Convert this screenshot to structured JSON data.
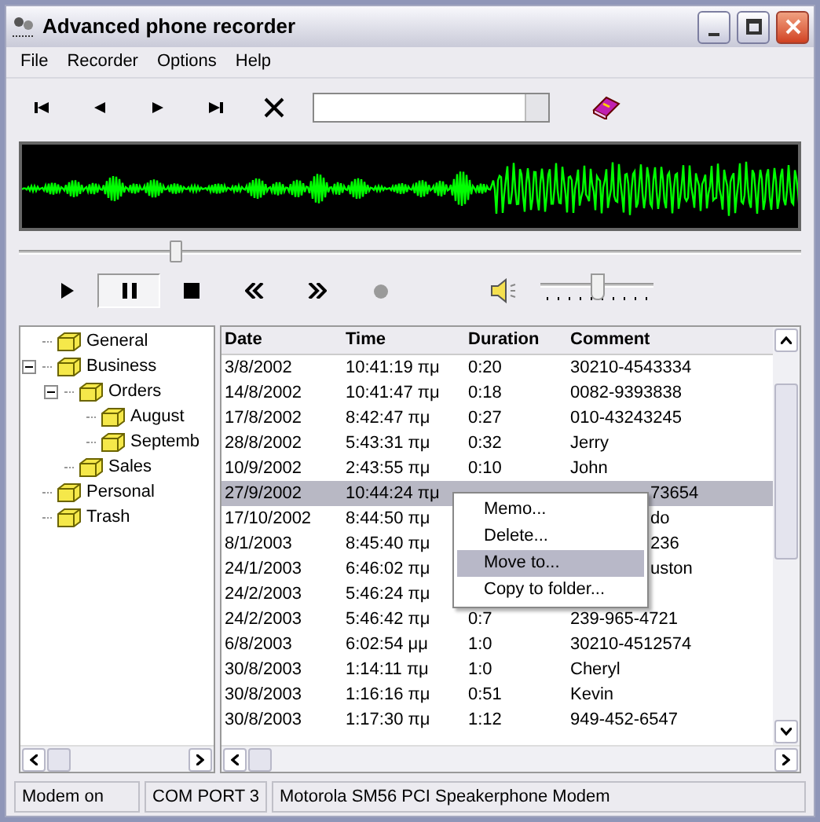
{
  "window": {
    "title": "Advanced phone recorder"
  },
  "menu": [
    "File",
    "Recorder",
    "Options",
    "Help"
  ],
  "position_slider": {
    "level": 0.2
  },
  "transport": [
    {
      "kind": "play",
      "pressed": false,
      "disabled": false
    },
    {
      "kind": "pause",
      "pressed": true,
      "disabled": false
    },
    {
      "kind": "stop",
      "pressed": false,
      "disabled": false
    },
    {
      "kind": "rewind",
      "pressed": false,
      "disabled": false
    },
    {
      "kind": "forward",
      "pressed": false,
      "disabled": false
    },
    {
      "kind": "record",
      "pressed": false,
      "disabled": true
    }
  ],
  "volume_slider": {
    "level": 0.5
  },
  "tree": [
    {
      "label": "General"
    },
    {
      "label": "Business",
      "expanded": true,
      "children": [
        {
          "label": "Orders",
          "expanded": true,
          "children": [
            {
              "label": "August"
            },
            {
              "label": "Septemb"
            }
          ]
        },
        {
          "label": "Sales"
        }
      ]
    },
    {
      "label": "Personal"
    },
    {
      "label": "Trash"
    }
  ],
  "table": {
    "columns": [
      "Date",
      "Time",
      "Duration",
      "Comment"
    ],
    "rows": [
      {
        "date": "3/8/2002",
        "time": "10:41:19 πμ",
        "duration": "0:20",
        "comment": "30210-4543334",
        "selected": false
      },
      {
        "date": "14/8/2002",
        "time": "10:41:47 πμ",
        "duration": "0:18",
        "comment": "0082-9393838",
        "selected": false
      },
      {
        "date": "17/8/2002",
        "time": "8:42:47 πμ",
        "duration": "0:27",
        "comment": "010-43243245",
        "selected": false
      },
      {
        "date": "28/8/2002",
        "time": "5:43:31 πμ",
        "duration": "0:32",
        "comment": "Jerry",
        "selected": false
      },
      {
        "date": "10/9/2002",
        "time": "2:43:55 πμ",
        "duration": "0:10",
        "comment": "John",
        "selected": false
      },
      {
        "date": "27/9/2002",
        "time": "10:44:24 πμ",
        "comment": "73654",
        "comment_covered": true,
        "selected": true
      },
      {
        "date": "17/10/2002",
        "time": "8:44:50 πμ",
        "comment": "do",
        "comment_covered": true,
        "selected": false
      },
      {
        "date": "8/1/2003",
        "time": "8:45:40 πμ",
        "comment": "236",
        "comment_covered": true,
        "selected": false
      },
      {
        "date": "24/1/2003",
        "time": "6:46:02 πμ",
        "comment": "uston",
        "comment_covered": true,
        "selected": false
      },
      {
        "date": "24/2/2003",
        "time": "5:46:24 πμ",
        "selected": false
      },
      {
        "date": "24/2/2003",
        "time": "5:46:42 πμ",
        "duration": "0:7",
        "comment": "239-965-4721",
        "selected": false
      },
      {
        "date": "6/8/2003",
        "time": "6:02:54 μμ",
        "duration": "1:0",
        "comment": "30210-4512574",
        "selected": false
      },
      {
        "date": "30/8/2003",
        "time": "1:14:11 πμ",
        "duration": "1:0",
        "comment": "Cheryl",
        "selected": false
      },
      {
        "date": "30/8/2003",
        "time": "1:16:16 πμ",
        "duration": "0:51",
        "comment": "Kevin",
        "selected": false
      },
      {
        "date": "30/8/2003",
        "time": "1:17:30 πμ",
        "duration": "1:12",
        "comment": "949-452-6547",
        "selected": false
      }
    ]
  },
  "context_menu": {
    "items": [
      {
        "label": "Memo...",
        "selected": false
      },
      {
        "label": "Delete...",
        "selected": false
      },
      {
        "label": "Move to...",
        "selected": true
      },
      {
        "label": "Copy to folder...",
        "selected": false
      }
    ]
  },
  "status_bar": [
    "Modem on",
    "COM PORT 3",
    "Motorola SM56 PCI Speakerphone Modem"
  ]
}
